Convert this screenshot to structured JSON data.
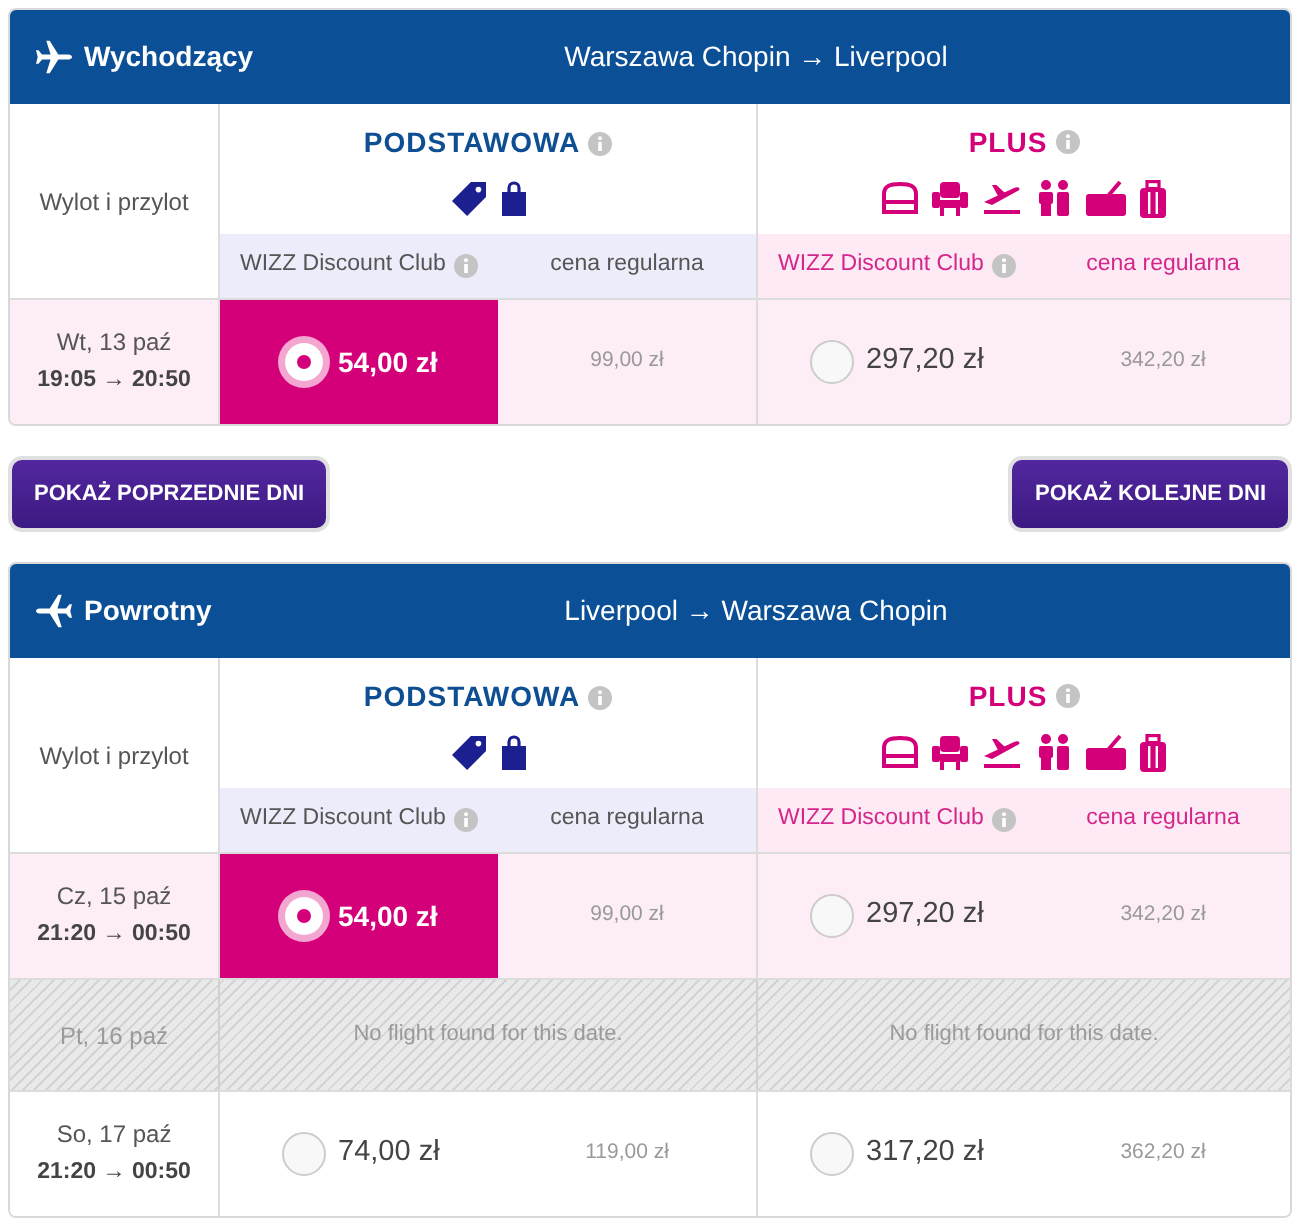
{
  "sections": [
    {
      "kind": "outbound",
      "title": "Wychodzący",
      "route": "Warszawa Chopin → Liverpool",
      "row_header": "Wylot i przylot",
      "fares": [
        {
          "kind": "basic",
          "name": "PODSTAWOWA",
          "club_label": "WIZZ Discount Club",
          "regular_label": "cena regularna"
        },
        {
          "kind": "plus",
          "name": "PLUS",
          "club_label": "WIZZ Discount Club",
          "regular_label": "cena regularna"
        }
      ],
      "rows": [
        {
          "kind": "flight",
          "date": "Wt, 13 paź",
          "times": "19:05 → 20:50",
          "prices": [
            {
              "club": "54,00 zł",
              "regular": "99,00 zł",
              "selected": true
            },
            {
              "club": "297,20 zł",
              "regular": "342,20 zł",
              "selected": false
            }
          ]
        }
      ]
    },
    {
      "kind": "day_buttons",
      "buttons": [
        "POKAŻ POPRZEDNIE DNI",
        "POKAŻ KOLEJNE DNI"
      ]
    },
    {
      "kind": "return",
      "title": "Powrotny",
      "route": "Liverpool → Warszawa Chopin",
      "row_header": "Wylot i przylot",
      "fares": [
        {
          "kind": "basic",
          "name": "PODSTAWOWA",
          "club_label": "WIZZ Discount Club",
          "regular_label": "cena regularna"
        },
        {
          "kind": "plus",
          "name": "PLUS",
          "club_label": "WIZZ Discount Club",
          "regular_label": "cena regularna"
        }
      ],
      "rows": [
        {
          "kind": "flight",
          "date": "Cz, 15 paź",
          "times": "21:20 → 00:50",
          "prices": [
            {
              "club": "54,00 zł",
              "regular": "99,00 zł",
              "selected": true
            },
            {
              "club": "297,20 zł",
              "regular": "342,20 zł",
              "selected": false
            }
          ]
        },
        {
          "kind": "no_flight",
          "date": "Pt, 16 paź",
          "messages": [
            "No flight found for this date.",
            "No flight found for this date."
          ]
        },
        {
          "kind": "flight",
          "date": "So, 17 paź",
          "times": "21:20 → 00:50",
          "prices": [
            {
              "club": "74,00 zł",
              "regular": "119,00 zł",
              "selected": false
            },
            {
              "club": "317,20 zł",
              "regular": "362,20 zł",
              "selected": false
            }
          ]
        }
      ]
    }
  ]
}
